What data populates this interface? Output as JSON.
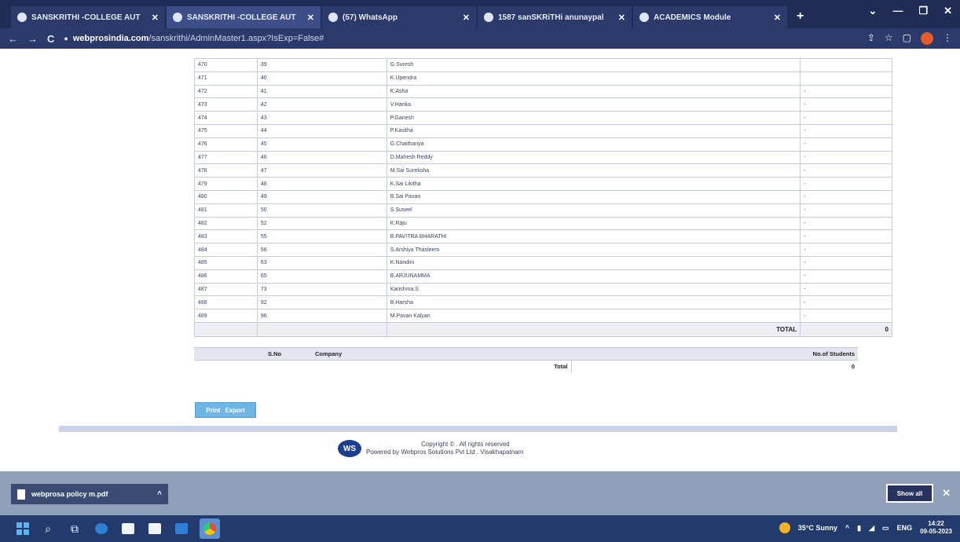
{
  "browser": {
    "tabs": [
      {
        "title": "SANSKRITHI -COLLEGE AUT",
        "active": false
      },
      {
        "title": "SANSKRITHI -COLLEGE AUT",
        "active": true
      },
      {
        "title": "(57) WhatsApp",
        "active": false
      },
      {
        "title": "1587 sanSKRiTHi anunaypal",
        "active": false
      },
      {
        "title": "ACADEMICS Module",
        "active": false
      }
    ],
    "url_host": "webprosindia.com",
    "url_path": "/sanskrithi/AdminMaster1.aspx?IsExp=False#"
  },
  "students": {
    "rows": [
      {
        "sno": "470",
        "roll": "39",
        "name": "G.Suresh",
        "value": ""
      },
      {
        "sno": "471",
        "roll": "40",
        "name": "K.Upendra",
        "value": ""
      },
      {
        "sno": "472",
        "roll": "41",
        "name": "K.Asha",
        "value": "-"
      },
      {
        "sno": "473",
        "roll": "42",
        "name": "V.Hanka",
        "value": "-"
      },
      {
        "sno": "474",
        "roll": "43",
        "name": "P.Ganesh",
        "value": "-"
      },
      {
        "sno": "475",
        "roll": "44",
        "name": "P.Kavitha",
        "value": "-"
      },
      {
        "sno": "476",
        "roll": "45",
        "name": "G.Chaithanya",
        "value": "-"
      },
      {
        "sno": "477",
        "roll": "46",
        "name": "D.Mahesh Reddy",
        "value": "-"
      },
      {
        "sno": "478",
        "roll": "47",
        "name": "M.Sai Sureksha",
        "value": "-"
      },
      {
        "sno": "479",
        "roll": "48",
        "name": "K.Sai Likitha",
        "value": "-"
      },
      {
        "sno": "480",
        "roll": "49",
        "name": "B.Sai Pavan",
        "value": "-"
      },
      {
        "sno": "481",
        "roll": "50",
        "name": "S.Suseel",
        "value": "-"
      },
      {
        "sno": "482",
        "roll": "52",
        "name": "K.Raju",
        "value": "-"
      },
      {
        "sno": "483",
        "roll": "55",
        "name": "B.PAVITRA BHARATHI",
        "value": "-"
      },
      {
        "sno": "484",
        "roll": "56",
        "name": "S.Arshiya Thasleem",
        "value": "-"
      },
      {
        "sno": "485",
        "roll": "63",
        "name": "K.Nandini",
        "value": "-"
      },
      {
        "sno": "486",
        "roll": "65",
        "name": "B.ARJUNAMMA",
        "value": "-"
      },
      {
        "sno": "487",
        "roll": "73",
        "name": "Karishma.S",
        "value": "-"
      },
      {
        "sno": "488",
        "roll": "92",
        "name": "B.Harsha",
        "value": "-"
      },
      {
        "sno": "489",
        "roll": "96",
        "name": "M.Pavan Kalyan",
        "value": "-"
      }
    ],
    "total_label": "TOTAL",
    "total_value": "0"
  },
  "companies": {
    "headers": {
      "sno": "S.No",
      "company": "Company",
      "count": "No.of Students"
    },
    "total_label": "Total",
    "total_value": "0"
  },
  "actions": {
    "print": "Print",
    "export": "Export"
  },
  "footer": {
    "copyright": "Copyright © . All rights reserved",
    "powered": "Powered by Webpros Solutions Pvt Ltd . Visakhapatnam",
    "logo_text": "WS"
  },
  "downloads": {
    "file": "webprosa policy m.pdf",
    "show_all": "Show all"
  },
  "taskbar": {
    "weather": "35°C Sunny",
    "lang": "ENG",
    "time": "14:22",
    "date": "09-05-2023"
  },
  "colors": {
    "tab_bar": "#1f2c55",
    "button": "#6fb6e6",
    "taskbar": "#233a6c"
  }
}
